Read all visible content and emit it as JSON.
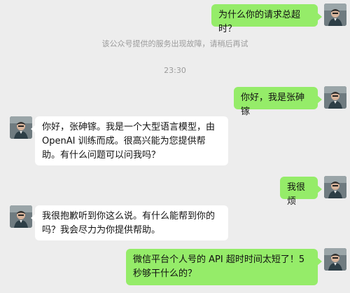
{
  "chat": {
    "system_notice": "该公众号提供的服务出现故障，请稍后再试",
    "timestamp": "23:30",
    "messages": [
      {
        "sender": "me",
        "text": "为什么你的请求总超时？"
      },
      {
        "sender": "me",
        "text": "你好，我是张砷镓"
      },
      {
        "sender": "other",
        "text": "你好，张砷镓。我是一个大型语言模型，由 OpenAI 训练而成。很高兴能为您提供帮助。有什么问题可以问我吗？"
      },
      {
        "sender": "me",
        "text": "我很烦"
      },
      {
        "sender": "other",
        "text": "我很抱歉听到你这么说。有什么能帮到你的吗？我会尽力为你提供帮助。"
      },
      {
        "sender": "me",
        "text": "微信平台个人号的 API 超时时间太短了！5秒够干什么的？"
      }
    ]
  },
  "colors": {
    "background": "#ededed",
    "my_bubble": "#95ec69",
    "other_bubble": "#ffffff",
    "system_text": "#9b9b9b"
  },
  "icons": {
    "avatar": "user-avatar-photo"
  }
}
